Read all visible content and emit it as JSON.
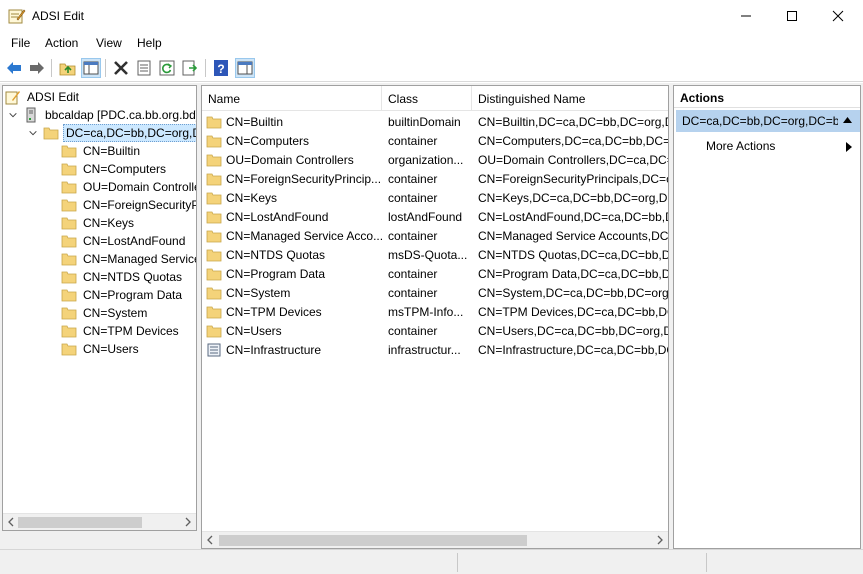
{
  "window": {
    "title": "ADSI Edit",
    "minimize_icon": "minimize-icon",
    "maximize_icon": "maximize-icon",
    "close_icon": "close-icon"
  },
  "menubar": {
    "items": [
      {
        "label": "File"
      },
      {
        "label": "Action"
      },
      {
        "label": "View"
      },
      {
        "label": "Help"
      }
    ]
  },
  "toolbar": {
    "buttons": [
      {
        "icon": "back-arrow-icon"
      },
      {
        "icon": "forward-arrow-icon"
      },
      {
        "icon": "up-folder-icon"
      },
      {
        "icon": "show-hide-console-tree-icon"
      },
      {
        "icon": "delete-icon"
      },
      {
        "icon": "properties-icon"
      },
      {
        "icon": "refresh-icon"
      },
      {
        "icon": "export-list-icon"
      },
      {
        "icon": "help-icon"
      },
      {
        "icon": "show-hide-action-pane-icon"
      }
    ]
  },
  "tree": {
    "root": "ADSI Edit",
    "connection": "bbcaldap [PDC.ca.bb.org.bd]",
    "domain": "DC=ca,DC=bb,DC=org,DC=bd",
    "children": [
      "CN=Builtin",
      "CN=Computers",
      "OU=Domain Controllers",
      "CN=ForeignSecurityPrincipals",
      "CN=Keys",
      "CN=LostAndFound",
      "CN=Managed Service Accounts",
      "CN=NTDS Quotas",
      "CN=Program Data",
      "CN=System",
      "CN=TPM Devices",
      "CN=Users"
    ]
  },
  "list": {
    "columns": [
      "Name",
      "Class",
      "Distinguished Name"
    ],
    "rows": [
      {
        "name": "CN=Builtin",
        "class": "builtinDomain",
        "dn": "CN=Builtin,DC=ca,DC=bb,DC=org,DC=bd",
        "icon": "folder-icon"
      },
      {
        "name": "CN=Computers",
        "class": "container",
        "dn": "CN=Computers,DC=ca,DC=bb,DC=org,DC=bd",
        "icon": "folder-icon"
      },
      {
        "name": "OU=Domain Controllers",
        "class": "organization...",
        "dn": "OU=Domain Controllers,DC=ca,DC=bb,DC=org,DC=bd",
        "icon": "folder-icon"
      },
      {
        "name": "CN=ForeignSecurityPrincip...",
        "class": "container",
        "dn": "CN=ForeignSecurityPrincipals,DC=ca,DC=bb,DC=org,DC=bd",
        "icon": "folder-icon"
      },
      {
        "name": "CN=Keys",
        "class": "container",
        "dn": "CN=Keys,DC=ca,DC=bb,DC=org,DC=bd",
        "icon": "folder-icon"
      },
      {
        "name": "CN=LostAndFound",
        "class": "lostAndFound",
        "dn": "CN=LostAndFound,DC=ca,DC=bb,DC=org,DC=bd",
        "icon": "folder-icon"
      },
      {
        "name": "CN=Managed Service Acco...",
        "class": "container",
        "dn": "CN=Managed Service Accounts,DC=ca,DC=bb,DC=org,DC=bd",
        "icon": "folder-icon"
      },
      {
        "name": "CN=NTDS Quotas",
        "class": "msDS-Quota...",
        "dn": "CN=NTDS Quotas,DC=ca,DC=bb,DC=org,DC=bd",
        "icon": "folder-icon"
      },
      {
        "name": "CN=Program Data",
        "class": "container",
        "dn": "CN=Program Data,DC=ca,DC=bb,DC=org,DC=bd",
        "icon": "folder-icon"
      },
      {
        "name": "CN=System",
        "class": "container",
        "dn": "CN=System,DC=ca,DC=bb,DC=org,DC=bd",
        "icon": "folder-icon"
      },
      {
        "name": "CN=TPM Devices",
        "class": "msTPM-Info...",
        "dn": "CN=TPM Devices,DC=ca,DC=bb,DC=org,DC=bd",
        "icon": "folder-icon"
      },
      {
        "name": "CN=Users",
        "class": "container",
        "dn": "CN=Users,DC=ca,DC=bb,DC=org,DC=bd",
        "icon": "folder-icon"
      },
      {
        "name": "CN=Infrastructure",
        "class": "infrastructur...",
        "dn": "CN=Infrastructure,DC=ca,DC=bb,DC=org,DC=bd",
        "icon": "object-icon"
      }
    ]
  },
  "actions": {
    "title": "Actions",
    "section": "DC=ca,DC=bb,DC=org,DC=bd",
    "items": [
      {
        "label": "More Actions"
      }
    ]
  },
  "colors": {
    "selection": "#cce8ff",
    "actions_section": "#b6d2ee",
    "folder": "#f4d37a"
  }
}
